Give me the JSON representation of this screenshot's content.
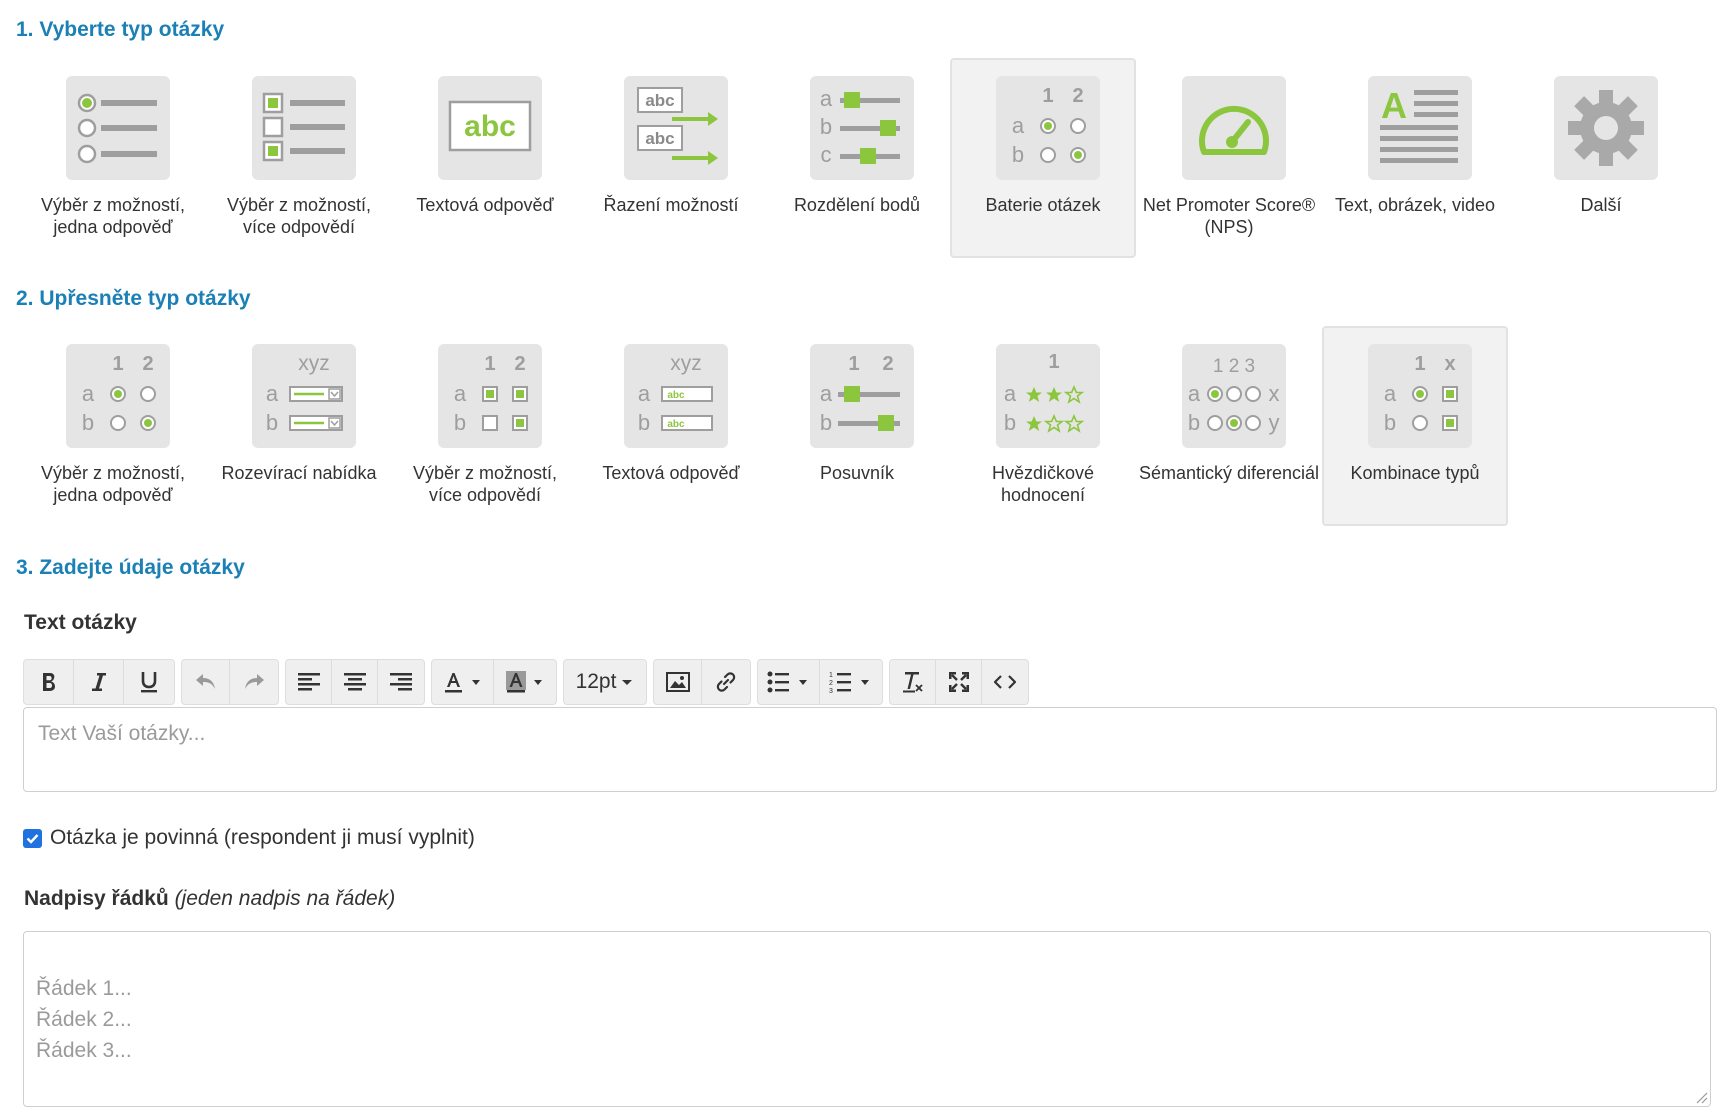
{
  "step1": {
    "title": "1. Vyberte typ otázky",
    "types": [
      {
        "label": "Výběr z možností, jedna odpověď",
        "icon": "single-choice-icon",
        "selected": false
      },
      {
        "label": "Výběr z možností, více odpovědí",
        "icon": "multiple-choice-icon",
        "selected": false
      },
      {
        "label": "Textová odpověď",
        "icon": "text-answer-icon",
        "selected": false
      },
      {
        "label": "Řazení možností",
        "icon": "ranking-icon",
        "selected": false
      },
      {
        "label": "Rozdělení bodů",
        "icon": "point-distribution-icon",
        "selected": false
      },
      {
        "label": "Baterie otázek",
        "icon": "question-battery-icon",
        "selected": true
      },
      {
        "label": "Net Promoter Score® (NPS)",
        "icon": "nps-gauge-icon",
        "selected": false
      },
      {
        "label": "Text, obrázek, video",
        "icon": "text-image-video-icon",
        "selected": false
      },
      {
        "label": "Další",
        "icon": "gear-icon",
        "selected": false
      }
    ]
  },
  "step2": {
    "title": "2. Upřesněte typ otázky",
    "types": [
      {
        "label": "Výběr z možností, jedna odpověď",
        "icon": "matrix-single-choice-icon",
        "selected": false
      },
      {
        "label": "Rozevírací nabídka",
        "icon": "matrix-dropdown-icon",
        "selected": false
      },
      {
        "label": "Výběr z možností, více odpovědí",
        "icon": "matrix-multiple-choice-icon",
        "selected": false
      },
      {
        "label": "Textová odpověď",
        "icon": "matrix-text-icon",
        "selected": false
      },
      {
        "label": "Posuvník",
        "icon": "matrix-slider-icon",
        "selected": false
      },
      {
        "label": "Hvězdičkové hodnocení",
        "icon": "matrix-star-rating-icon",
        "selected": false
      },
      {
        "label": "Sémantický diferenciál",
        "icon": "semantic-differential-icon",
        "selected": false
      },
      {
        "label": "Kombinace typů",
        "icon": "matrix-combination-icon",
        "selected": true
      }
    ],
    "icon_text": {
      "cols12": [
        "1",
        "2"
      ],
      "rows_ab": [
        "a",
        "b"
      ],
      "xyz": "xyz",
      "abc": "abc",
      "star_col": "1",
      "sem_cols": "1 2 3",
      "sem_left": [
        "a",
        "b"
      ],
      "sem_right": [
        "x",
        "y"
      ],
      "combo_cols": [
        "1",
        "x"
      ]
    }
  },
  "step1_icon_text": {
    "abc": "abc",
    "rows_abc": [
      "a",
      "b",
      "c"
    ],
    "cols12": [
      "1",
      "2"
    ],
    "rows_ab": [
      "a",
      "b"
    ],
    "big_a": "A"
  },
  "step3": {
    "title": "3. Zadejte údaje otázky",
    "question_text_label": "Text otázky",
    "font_size": "12pt",
    "editor_placeholder": "Text Vaší otázky...",
    "required_checked": true,
    "required_label": "Otázka je povinná (respondent ji musí vyplnit)",
    "row_headings_label": "Nadpisy řádků",
    "row_headings_hint": "(jeden nadpis na řádek)",
    "rows_placeholder": "Řádek 1...\nŘádek 2...\nŘádek 3..."
  },
  "colors": {
    "accent_green": "#8cc63f",
    "title_blue": "#1a80b6",
    "icon_gray": "#9e9e9e",
    "tile_bg": "#e5e5e5",
    "checkbox_blue": "#1f72e0"
  }
}
